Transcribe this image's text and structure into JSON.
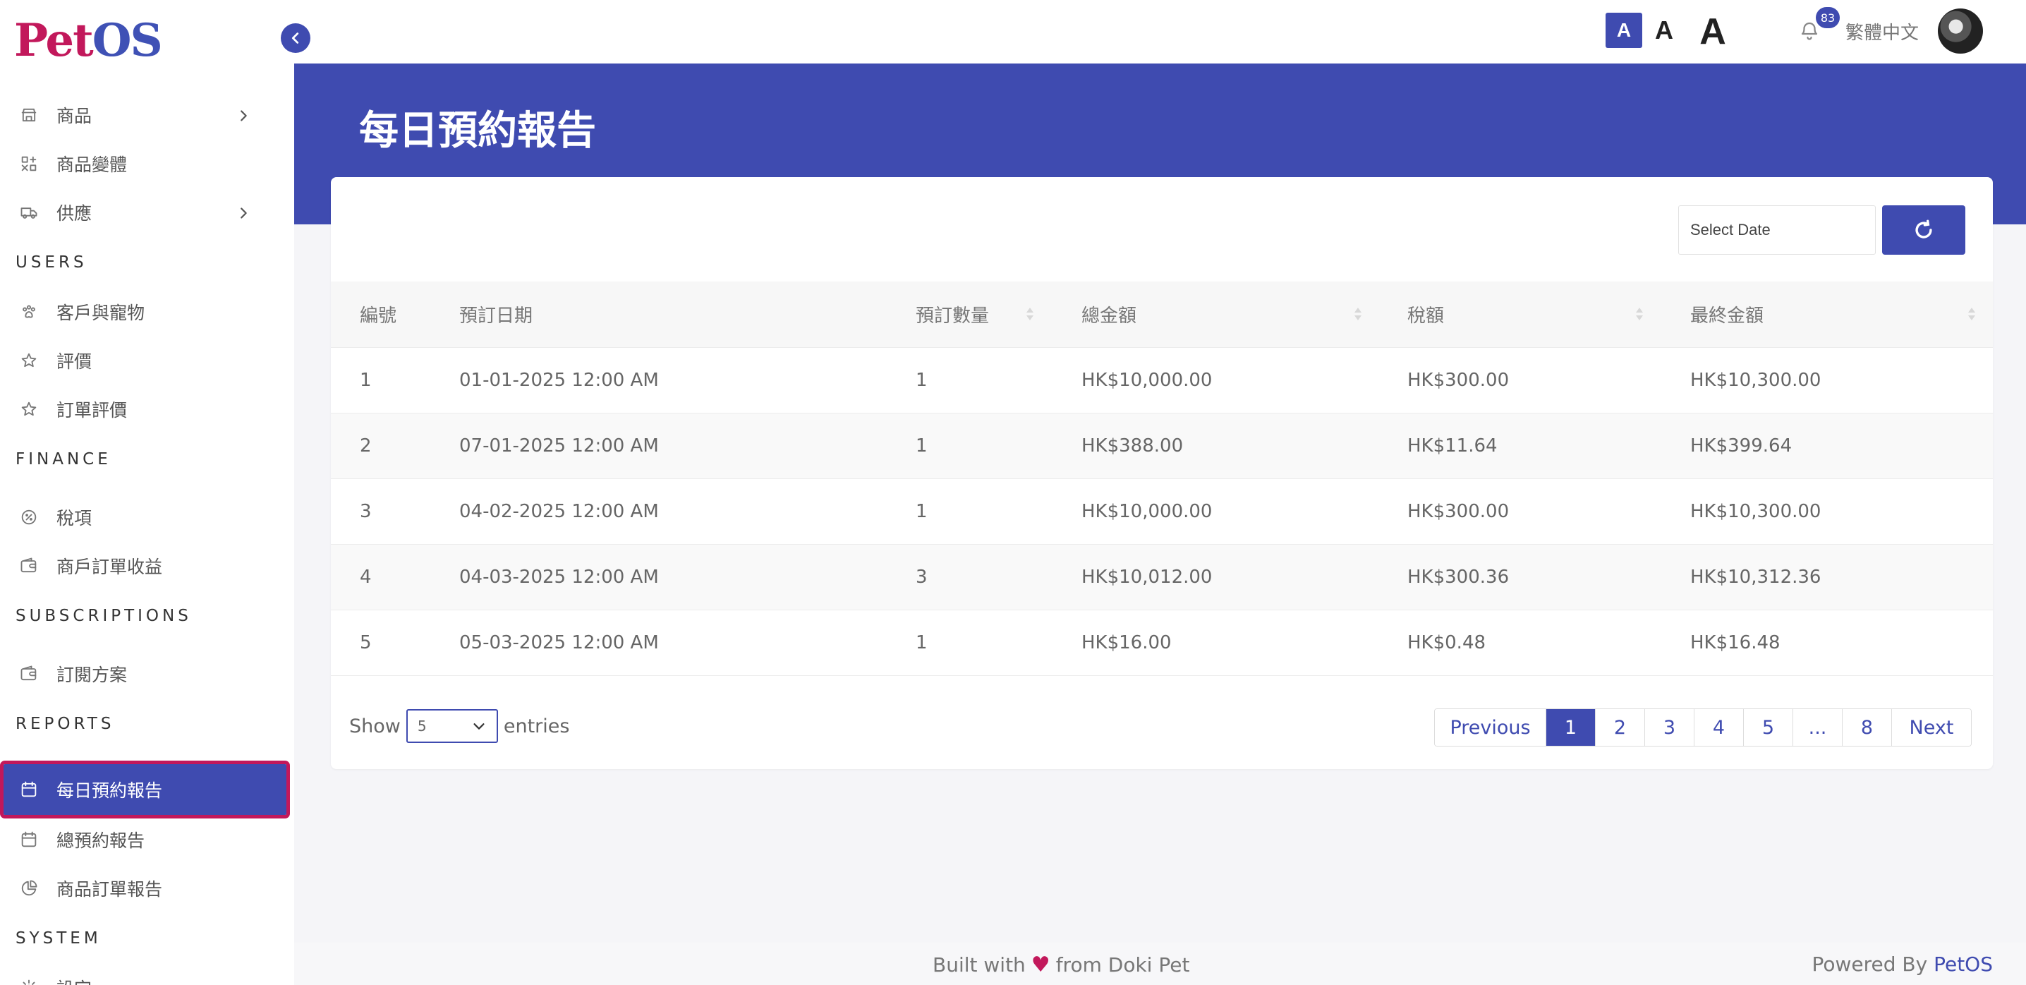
{
  "brand": {
    "logo_part1": "Pet",
    "logo_part2": "OS"
  },
  "sidebar": {
    "items": [
      {
        "type": "item",
        "name": "sidebar-item-products",
        "icon": "store-icon",
        "label": "商品",
        "chevron": true
      },
      {
        "type": "item",
        "name": "sidebar-item-product-variants",
        "icon": "variants-icon",
        "label": "商品變體",
        "chevron": false
      },
      {
        "type": "item",
        "name": "sidebar-item-supply",
        "icon": "truck-icon",
        "label": "供應",
        "chevron": true
      },
      {
        "type": "section",
        "label": "USERS"
      },
      {
        "type": "item",
        "name": "sidebar-item-customers-pets",
        "icon": "paw-icon",
        "label": "客戶與寵物",
        "chevron": false
      },
      {
        "type": "item",
        "name": "sidebar-item-reviews",
        "icon": "star-icon",
        "label": "評價",
        "chevron": false
      },
      {
        "type": "item",
        "name": "sidebar-item-order-reviews",
        "icon": "star-icon",
        "label": "訂單評價",
        "chevron": false
      },
      {
        "type": "section",
        "label": "FINANCE"
      },
      {
        "type": "item",
        "name": "sidebar-item-tax",
        "icon": "percent-icon",
        "label": "稅項",
        "chevron": false
      },
      {
        "type": "item",
        "name": "sidebar-item-merchant-revenue",
        "icon": "wallet-icon",
        "label": "商戶訂單收益",
        "chevron": false
      },
      {
        "type": "section",
        "label": "SUBSCRIPTIONS"
      },
      {
        "type": "item",
        "name": "sidebar-item-subscription-plans",
        "icon": "wallet-icon",
        "label": "訂閱方案",
        "chevron": false
      },
      {
        "type": "section",
        "label": "REPORTS"
      },
      {
        "type": "item",
        "name": "sidebar-item-daily-booking-report",
        "icon": "calendar-icon",
        "label": "每日預約報告",
        "chevron": false,
        "active": true
      },
      {
        "type": "item",
        "name": "sidebar-item-total-booking-report",
        "icon": "calendar-icon",
        "label": "總預約報告",
        "chevron": false
      },
      {
        "type": "item",
        "name": "sidebar-item-product-order-report",
        "icon": "pie-chart-icon",
        "label": "商品訂單報告",
        "chevron": false
      },
      {
        "type": "section",
        "label": "SYSTEM"
      },
      {
        "type": "item",
        "name": "sidebar-item-settings",
        "icon": "gear-icon",
        "label": "設定",
        "chevron": false
      }
    ]
  },
  "topbar": {
    "font_small": "A",
    "font_medium": "A",
    "font_large": "A",
    "notification_count": "83",
    "language": "繁體中文"
  },
  "page": {
    "title": "每日預約報告"
  },
  "filter": {
    "date_placeholder": "Select Date"
  },
  "table": {
    "headers": [
      "編號",
      "預訂日期",
      "預訂數量",
      "總金額",
      "稅額",
      "最終金額"
    ],
    "rows": [
      [
        "1",
        "01-01-2025 12:00 AM",
        "1",
        "HK$10,000.00",
        "HK$300.00",
        "HK$10,300.00"
      ],
      [
        "2",
        "07-01-2025 12:00 AM",
        "1",
        "HK$388.00",
        "HK$11.64",
        "HK$399.64"
      ],
      [
        "3",
        "04-02-2025 12:00 AM",
        "1",
        "HK$10,000.00",
        "HK$300.00",
        "HK$10,300.00"
      ],
      [
        "4",
        "04-03-2025 12:00 AM",
        "3",
        "HK$10,012.00",
        "HK$300.36",
        "HK$10,312.36"
      ],
      [
        "5",
        "05-03-2025 12:00 AM",
        "1",
        "HK$16.00",
        "HK$0.48",
        "HK$16.48"
      ]
    ]
  },
  "entries": {
    "show_label": "Show",
    "value": "5",
    "suffix": "entries"
  },
  "pagination": {
    "previous": "Previous",
    "pages": [
      "1",
      "2",
      "3",
      "4",
      "5",
      "...",
      "8"
    ],
    "current": "1",
    "next": "Next"
  },
  "footer": {
    "built_prefix": "Built with",
    "built_suffix": "from Doki Pet",
    "powered_prefix": "Powered By",
    "powered_brand": "PetOS"
  },
  "colors": {
    "primary": "#3f4bb0",
    "accent": "#c2185b"
  }
}
